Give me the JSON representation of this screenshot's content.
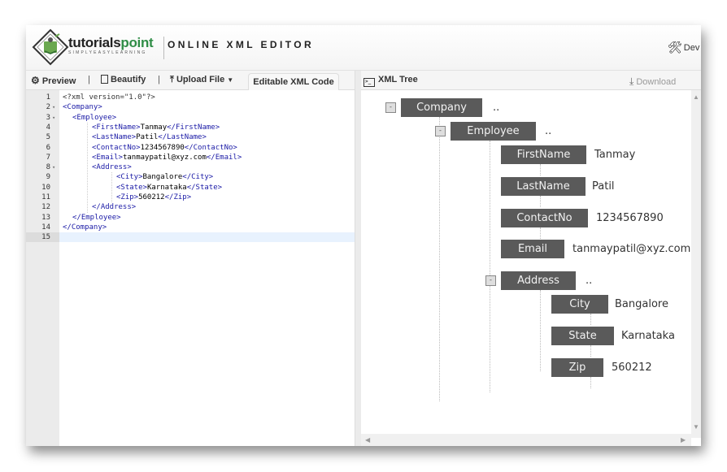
{
  "header": {
    "brand_name_a": "tutorials",
    "brand_name_b": "point",
    "brand_tagline": "SIMPLYEASYLEARNING",
    "app_title": "ONLINE XML EDITOR",
    "devtools_label": "Dev T"
  },
  "left_toolbar": {
    "preview_label": "Preview",
    "beautify_label": "Beautify",
    "upload_label": "Upload File",
    "separator": "|",
    "active_tab": "Editable XML Code"
  },
  "editor": {
    "lines": [
      {
        "n": "1",
        "fold": "",
        "indent": 0,
        "parts": [
          [
            "pi",
            "<?xml version=\"1.0\"?>"
          ]
        ]
      },
      {
        "n": "2",
        "fold": "▾",
        "indent": 0,
        "parts": [
          [
            "tag",
            "<Company>"
          ]
        ]
      },
      {
        "n": "3",
        "fold": "▾",
        "indent": 1,
        "parts": [
          [
            "tag",
            "<Employee>"
          ]
        ]
      },
      {
        "n": "4",
        "fold": "",
        "indent": 2,
        "parts": [
          [
            "tag",
            "<FirstName>"
          ],
          [
            "txt",
            "Tanmay"
          ],
          [
            "tag",
            "</FirstName>"
          ]
        ]
      },
      {
        "n": "5",
        "fold": "",
        "indent": 2,
        "parts": [
          [
            "tag",
            "<LastName>"
          ],
          [
            "txt",
            "Patil"
          ],
          [
            "tag",
            "</LastName>"
          ]
        ]
      },
      {
        "n": "6",
        "fold": "",
        "indent": 2,
        "parts": [
          [
            "tag",
            "<ContactNo>"
          ],
          [
            "txt",
            "1234567890"
          ],
          [
            "tag",
            "</ContactNo>"
          ]
        ]
      },
      {
        "n": "7",
        "fold": "",
        "indent": 2,
        "parts": [
          [
            "tag",
            "<Email>"
          ],
          [
            "txt",
            "tanmaypatil@xyz.com"
          ],
          [
            "tag",
            "</Email>"
          ]
        ]
      },
      {
        "n": "8",
        "fold": "▾",
        "indent": 2,
        "parts": [
          [
            "tag",
            "<Address>"
          ]
        ]
      },
      {
        "n": "9",
        "fold": "",
        "indent": 3,
        "parts": [
          [
            "tag",
            "<City>"
          ],
          [
            "txt",
            "Bangalore"
          ],
          [
            "tag",
            "</City>"
          ]
        ]
      },
      {
        "n": "10",
        "fold": "",
        "indent": 3,
        "parts": [
          [
            "tag",
            "<State>"
          ],
          [
            "txt",
            "Karnataka"
          ],
          [
            "tag",
            "</State>"
          ]
        ]
      },
      {
        "n": "11",
        "fold": "",
        "indent": 3,
        "parts": [
          [
            "tag",
            "<Zip>"
          ],
          [
            "txt",
            "560212"
          ],
          [
            "tag",
            "</Zip>"
          ]
        ]
      },
      {
        "n": "12",
        "fold": "",
        "indent": 2,
        "parts": [
          [
            "tag",
            "</Address>"
          ]
        ]
      },
      {
        "n": "13",
        "fold": "",
        "indent": 1,
        "parts": [
          [
            "tag",
            "</Employee>"
          ]
        ]
      },
      {
        "n": "14",
        "fold": "",
        "indent": 0,
        "parts": [
          [
            "tag",
            "</Company>"
          ]
        ]
      },
      {
        "n": "15",
        "fold": "",
        "indent": 0,
        "parts": [],
        "active": true
      }
    ]
  },
  "right_toolbar": {
    "title": "XML Tree",
    "download_label": "Download"
  },
  "tree": {
    "toggle_symbol": "-",
    "nodes": [
      {
        "name": "Company",
        "value": "..",
        "collapsible": true
      },
      {
        "name": "Employee",
        "value": "..",
        "collapsible": true
      },
      {
        "name": "FirstName",
        "value": "Tanmay"
      },
      {
        "name": "LastName",
        "value": "Patil"
      },
      {
        "name": "ContactNo",
        "value": "1234567890"
      },
      {
        "name": "Email",
        "value": "tanmaypatil@xyz.com"
      },
      {
        "name": "Address",
        "value": "..",
        "collapsible": true
      },
      {
        "name": "City",
        "value": "Bangalore"
      },
      {
        "name": "State",
        "value": "Karnataka"
      },
      {
        "name": "Zip",
        "value": "560212"
      }
    ]
  },
  "colors": {
    "tag": "#1a1aa6",
    "node_bg": "#5a5a5a",
    "active_line": "#e8f2fe"
  }
}
